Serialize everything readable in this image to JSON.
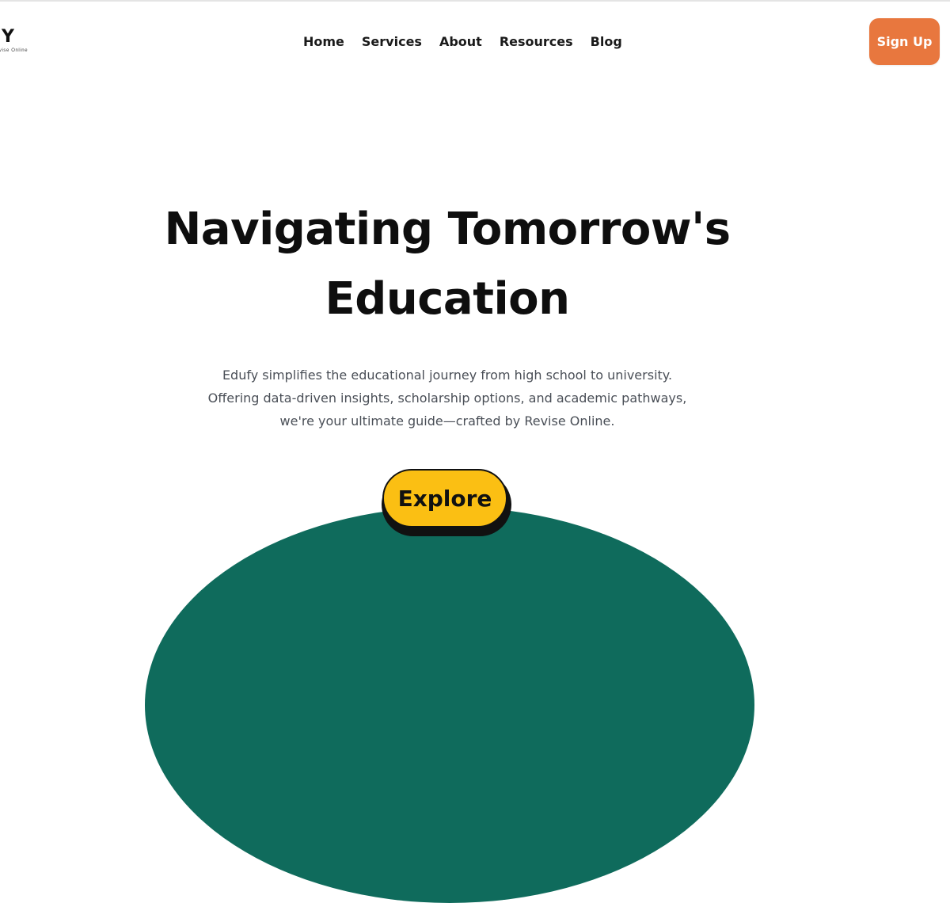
{
  "logo": {
    "wordmark": "FY",
    "tagline": "Revise Online"
  },
  "nav": {
    "items": [
      {
        "label": "Home"
      },
      {
        "label": "Services"
      },
      {
        "label": "About"
      },
      {
        "label": "Resources"
      },
      {
        "label": "Blog"
      }
    ],
    "signup_label": "Sign Up"
  },
  "hero": {
    "title_line1": "Navigating Tomorrow's",
    "title_line2": "Education",
    "subtitle_line1": "Edufy simplifies the educational journey from high school to university.",
    "subtitle_line2": "Offering data-driven insights, scholarship options, and academic pathways,",
    "subtitle_line3": "we're your ultimate guide—crafted by Revise Online.",
    "cta_label": "Explore"
  },
  "colors": {
    "accent_orange": "#e8773e",
    "cta_yellow": "#fbbf13",
    "hero_green": "#0f6b5c",
    "text_dark": "#0e0e0e",
    "text_muted": "#4a4f57"
  }
}
